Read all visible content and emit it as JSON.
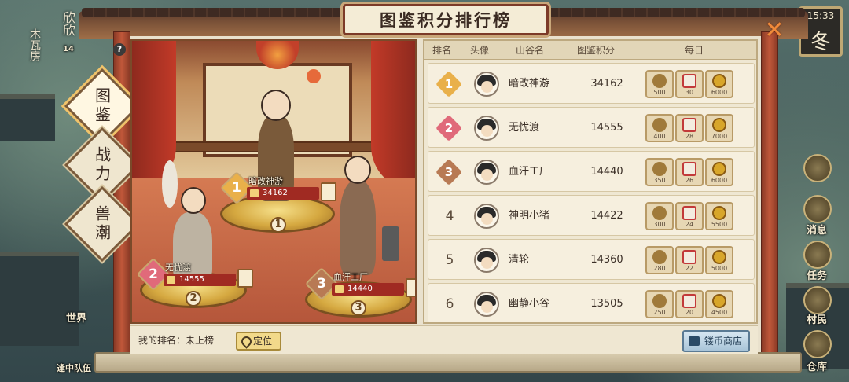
{
  "hud": {
    "time": "15:33",
    "season": "冬",
    "left_names": [
      "欣欣",
      "木瓦房"
    ],
    "left_badge": "14",
    "right_labels": [
      "消息",
      "任务",
      "村民",
      "仓库"
    ],
    "left_bottom": [
      "世界",
      "逢中队伍"
    ]
  },
  "panel": {
    "title": "图鉴积分排行榜"
  },
  "side_tabs": [
    {
      "label": "图鉴",
      "active": true
    },
    {
      "label": "战力",
      "active": false
    },
    {
      "label": "兽潮",
      "active": false
    }
  ],
  "podium": [
    {
      "rank": "1",
      "name": "暗改神游",
      "score": "34162"
    },
    {
      "rank": "2",
      "name": "无忧渡",
      "score": "14555"
    },
    {
      "rank": "3",
      "name": "血汗工厂",
      "score": "14440"
    }
  ],
  "table": {
    "headers": [
      "排名",
      "头像",
      "山谷名",
      "图鉴积分",
      "每日"
    ],
    "rows": [
      {
        "rank": "1",
        "name": "暗改神游",
        "score": "34162",
        "rewards": [
          "500",
          "30",
          "6000"
        ]
      },
      {
        "rank": "2",
        "name": "无忧渡",
        "score": "14555",
        "rewards": [
          "400",
          "28",
          "7000"
        ]
      },
      {
        "rank": "3",
        "name": "血汗工厂",
        "score": "14440",
        "rewards": [
          "350",
          "26",
          "6000"
        ]
      },
      {
        "rank": "4",
        "name": "神明小猪",
        "score": "14422",
        "rewards": [
          "300",
          "24",
          "5500"
        ]
      },
      {
        "rank": "5",
        "name": "清轮",
        "score": "14360",
        "rewards": [
          "280",
          "22",
          "5000"
        ]
      },
      {
        "rank": "6",
        "name": "幽静小谷",
        "score": "13505",
        "rewards": [
          "250",
          "20",
          "4500"
        ]
      }
    ]
  },
  "bottom": {
    "my_rank": "我的排名：未上榜",
    "locate_label": "定位",
    "shop_label": "镂币商店"
  },
  "colors": {
    "rank1": "#e9b04a",
    "rank2": "#e06a7a",
    "rank3": "#b87a54",
    "accent": "#7c3a28"
  }
}
